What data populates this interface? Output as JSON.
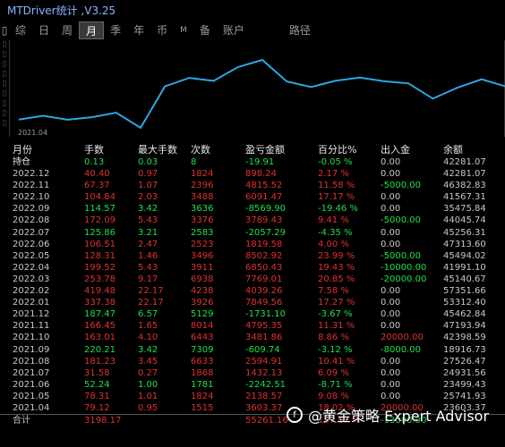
{
  "window": {
    "title": "MTDriver统计 ,V3.25"
  },
  "tabs": [
    {
      "label": "综",
      "small": false,
      "active": false
    },
    {
      "label": "日",
      "small": false,
      "active": false
    },
    {
      "label": "周",
      "small": false,
      "active": false
    },
    {
      "label": "月",
      "small": false,
      "active": true
    },
    {
      "label": "季",
      "small": false,
      "active": false
    },
    {
      "label": "年",
      "small": false,
      "active": false
    },
    {
      "label": "币",
      "small": false,
      "active": false
    },
    {
      "label": "M",
      "small": true,
      "active": false
    },
    {
      "label": "备",
      "small": false,
      "active": false
    },
    {
      "label": "账户",
      "small": false,
      "active": false
    }
  ],
  "path_tab": "路径",
  "chart": {
    "date_label": "2021.04",
    "line_color": "#2aa8e0"
  },
  "headers": [
    "月份",
    "手数",
    "最大手数",
    "次数",
    "盈亏金额",
    "百分比%",
    "出入金",
    "余额"
  ],
  "rows": [
    {
      "month": "持仓",
      "lots": "0.13",
      "maxLots": "0.03",
      "count": "8",
      "pnl": "-19.91",
      "pct": "-0.05 %",
      "flow": "0.00",
      "balance": "42281.07",
      "tone": "pos"
    },
    {
      "month": "2022.12",
      "lots": "40.40",
      "maxLots": "0.97",
      "count": "1824",
      "pnl": "898.24",
      "pct": "2.17 %",
      "flow": "0.00",
      "balance": "42281.07",
      "tone": "neg"
    },
    {
      "month": "2022.11",
      "lots": "67.37",
      "maxLots": "1.07",
      "count": "2396",
      "pnl": "4815.52",
      "pct": "11.58 %",
      "flow": "-5000.00",
      "balance": "46382.83",
      "tone": "neg"
    },
    {
      "month": "2022.10",
      "lots": "104.84",
      "maxLots": "2.03",
      "count": "3488",
      "pnl": "6091.47",
      "pct": "17.17 %",
      "flow": "0.00",
      "balance": "41567.31",
      "tone": "neg"
    },
    {
      "month": "2022.09",
      "lots": "114.57",
      "maxLots": "3.42",
      "count": "3636",
      "pnl": "-8569.90",
      "pct": "-19.46 %",
      "flow": "0.00",
      "balance": "35475.84",
      "tone": "pos"
    },
    {
      "month": "2022.08",
      "lots": "172.09",
      "maxLots": "5.43",
      "count": "3376",
      "pnl": "3789.43",
      "pct": "9.41 %",
      "flow": "-5000.00",
      "balance": "44045.74",
      "tone": "neg"
    },
    {
      "month": "2022.07",
      "lots": "125.86",
      "maxLots": "3.21",
      "count": "2583",
      "pnl": "-2057.29",
      "pct": "-4.35 %",
      "flow": "0.00",
      "balance": "45256.31",
      "tone": "pos"
    },
    {
      "month": "2022.06",
      "lots": "106.51",
      "maxLots": "2.47",
      "count": "2523",
      "pnl": "1819.58",
      "pct": "4.00 %",
      "flow": "0.00",
      "balance": "47313.60",
      "tone": "neg"
    },
    {
      "month": "2022.05",
      "lots": "128.31",
      "maxLots": "1.46",
      "count": "3496",
      "pnl": "8502.92",
      "pct": "23.99 %",
      "flow": "-5000.00",
      "balance": "45494.02",
      "tone": "neg"
    },
    {
      "month": "2022.04",
      "lots": "199.52",
      "maxLots": "5.43",
      "count": "3911",
      "pnl": "6850.43",
      "pct": "19.43 %",
      "flow": "-10000.00",
      "balance": "41991.10",
      "tone": "neg"
    },
    {
      "month": "2022.03",
      "lots": "253.78",
      "maxLots": "9.17",
      "count": "6938",
      "pnl": "7769.01",
      "pct": "20.85 %",
      "flow": "-20000.00",
      "balance": "45140.67",
      "tone": "neg"
    },
    {
      "month": "2022.02",
      "lots": "419.48",
      "maxLots": "22.17",
      "count": "4238",
      "pnl": "4039.26",
      "pct": "7.58 %",
      "flow": "0.00",
      "balance": "57351.66",
      "tone": "neg"
    },
    {
      "month": "2022.01",
      "lots": "337.38",
      "maxLots": "22.17",
      "count": "3926",
      "pnl": "7849.56",
      "pct": "17.27 %",
      "flow": "0.00",
      "balance": "53312.40",
      "tone": "neg"
    },
    {
      "month": "2021.12",
      "lots": "187.47",
      "maxLots": "6.57",
      "count": "5129",
      "pnl": "-1731.10",
      "pct": "-3.67 %",
      "flow": "0.00",
      "balance": "45462.84",
      "tone": "pos"
    },
    {
      "month": "2021.11",
      "lots": "166.45",
      "maxLots": "1.65",
      "count": "8014",
      "pnl": "4795.35",
      "pct": "11.31 %",
      "flow": "0.00",
      "balance": "47193.94",
      "tone": "neg"
    },
    {
      "month": "2021.10",
      "lots": "163.01",
      "maxLots": "4.10",
      "count": "6443",
      "pnl": "3481.86",
      "pct": "8.86 %",
      "flow": "20000.00",
      "balance": "42398.59",
      "tone": "neg"
    },
    {
      "month": "2021.09",
      "lots": "220.21",
      "maxLots": "3.42",
      "count": "7309",
      "pnl": "-609.74",
      "pct": "-3.12 %",
      "flow": "-8000.00",
      "balance": "18916.73",
      "tone": "pos"
    },
    {
      "month": "2021.08",
      "lots": "181.23",
      "maxLots": "3.45",
      "count": "6633",
      "pnl": "2594.91",
      "pct": "10.41 %",
      "flow": "0.00",
      "balance": "27526.47",
      "tone": "neg"
    },
    {
      "month": "2021.07",
      "lots": "31.58",
      "maxLots": "0.27",
      "count": "1868",
      "pnl": "1432.13",
      "pct": "6.09 %",
      "flow": "0.00",
      "balance": "24931.56",
      "tone": "neg"
    },
    {
      "month": "2021.06",
      "lots": "52.24",
      "maxLots": "1.00",
      "count": "1781",
      "pnl": "-2242.51",
      "pct": "-8.71 %",
      "flow": "0.00",
      "balance": "23499.43",
      "tone": "pos"
    },
    {
      "month": "2021.05",
      "lots": "78.31",
      "maxLots": "1.01",
      "count": "1824",
      "pnl": "2138.57",
      "pct": "9.08 %",
      "flow": "0.00",
      "balance": "25741.93",
      "tone": "neg"
    },
    {
      "month": "2021.04",
      "lots": "79.12",
      "maxLots": "0.95",
      "count": "1515",
      "pnl": "3603.37",
      "pct": "18.02 %",
      "flow": "20000.00",
      "balance": "23603.37",
      "tone": "neg"
    }
  ],
  "total": {
    "month": "合计",
    "lots": "3198.17",
    "maxLots": "",
    "count": "",
    "pnl": "55261.16",
    "pct": "157.00 %",
    "flow": "-13000.00",
    "balance": "",
    "tone": "neg"
  },
  "watermark": {
    "text": "@黄金策略 Expert Advisor"
  }
}
